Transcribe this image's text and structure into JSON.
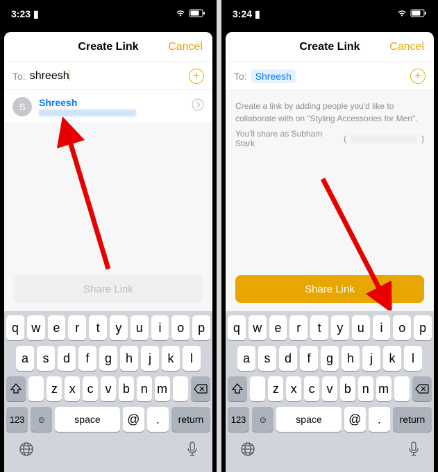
{
  "left": {
    "status": {
      "time": "3:23",
      "indicator": "▮"
    },
    "header": {
      "title": "Create Link",
      "cancel": "Cancel"
    },
    "to": {
      "label": "To:",
      "value": "shreesh"
    },
    "contact": {
      "initial": "S",
      "name": "Shreesh"
    },
    "share_button": "Share Link"
  },
  "right": {
    "status": {
      "time": "3:24",
      "indicator": "▮"
    },
    "header": {
      "title": "Create Link",
      "cancel": "Cancel"
    },
    "to": {
      "label": "To:",
      "pill": "Shreesh"
    },
    "info_text": "Create a link by adding people you'd like to collaborate with on \"Styling Accessories for Men\".",
    "share_as_prefix": "You'll share as Subham  Stark",
    "share_button": "Share Link"
  },
  "keyboard": {
    "row1": [
      "q",
      "w",
      "e",
      "r",
      "t",
      "y",
      "u",
      "i",
      "o",
      "p"
    ],
    "row2": [
      "a",
      "s",
      "d",
      "f",
      "g",
      "h",
      "j",
      "k",
      "l"
    ],
    "row3": [
      "z",
      "x",
      "c",
      "v",
      "b",
      "n",
      "m"
    ],
    "numkey": "123",
    "space": "space",
    "at": "@",
    "dot": ".",
    "return": "return"
  },
  "colors": {
    "accent": "#e7a600",
    "link": "#007aff"
  }
}
